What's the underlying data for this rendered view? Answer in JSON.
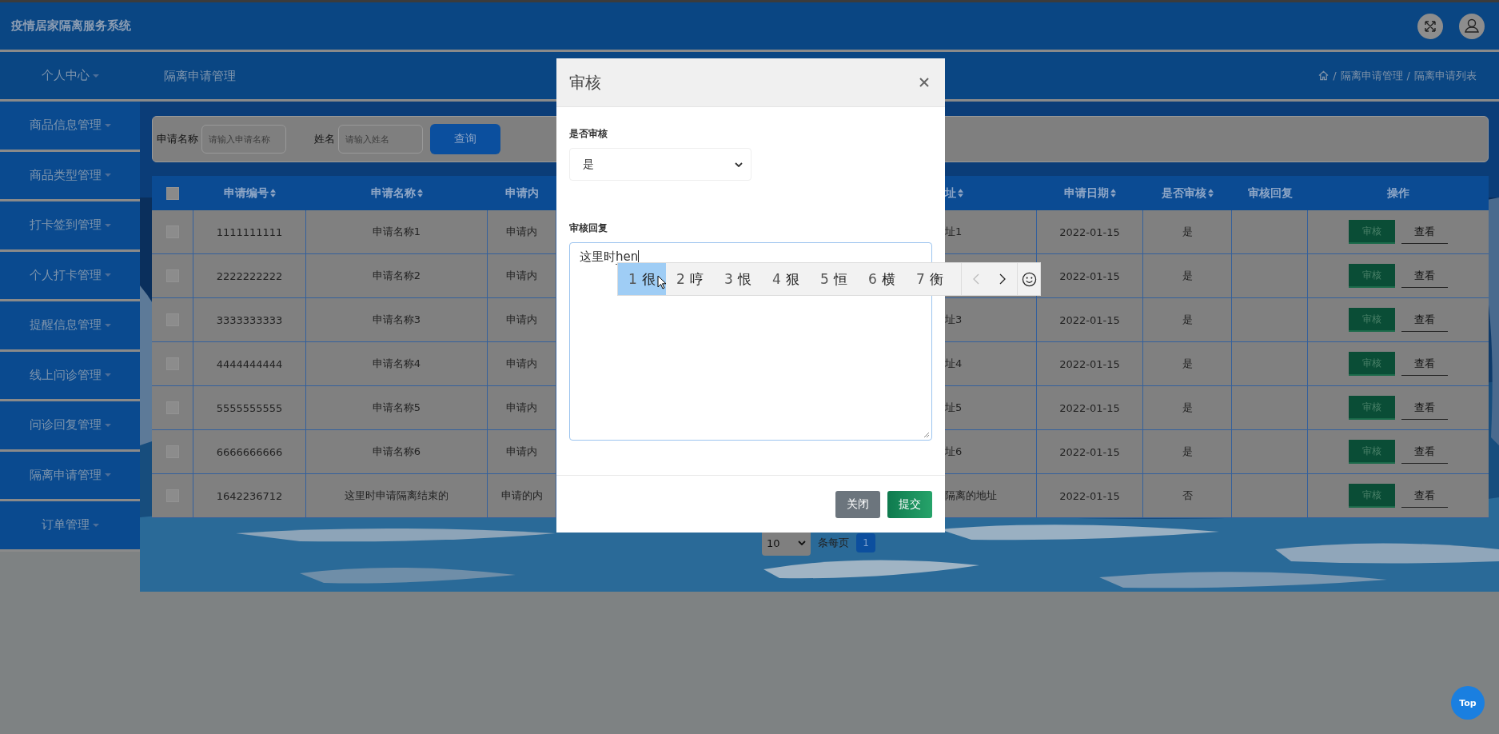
{
  "header": {
    "title": "疫情居家隔离服务系统"
  },
  "nav": {
    "user_menu": "个人中心",
    "page_title": "隔离申请管理",
    "breadcrumb": {
      "separator": "/",
      "items": [
        "隔离申请管理",
        "隔离申请列表"
      ]
    }
  },
  "sidebar": {
    "items": [
      "商品信息管理",
      "商品类型管理",
      "打卡签到管理",
      "个人打卡管理",
      "提醒信息管理",
      "线上问诊管理",
      "问诊回复管理",
      "隔离申请管理",
      "订单管理"
    ]
  },
  "search": {
    "fields": [
      {
        "label": "申请名称",
        "placeholder": "请输入申请名称"
      },
      {
        "label": "姓名",
        "placeholder": "请输入姓名"
      }
    ],
    "button": "查询"
  },
  "table": {
    "header_checked": false,
    "columns": [
      {
        "label": "申请编号",
        "sortable": true
      },
      {
        "label": "申请名称",
        "sortable": true
      },
      {
        "label": "申请内",
        "sortable": false
      },
      {
        "label": "址",
        "sortable": true
      },
      {
        "label": "申请日期",
        "sortable": true
      },
      {
        "label": "是否审核",
        "sortable": true
      },
      {
        "label": "审核回复",
        "sortable": false
      },
      {
        "label": "操作",
        "sortable": false
      }
    ],
    "rows": [
      {
        "checked": false,
        "id": "1111111111",
        "name": "申请名称1",
        "content": "申请内",
        "address": "址1",
        "date": "2022-01-15",
        "reviewed": "是",
        "actions": [
          "审核",
          "查看"
        ]
      },
      {
        "checked": false,
        "id": "2222222222",
        "name": "申请名称2",
        "content": "申请内",
        "date": "2022-01-15",
        "reviewed": "是",
        "actions": [
          "审核",
          "查看"
        ]
      },
      {
        "checked": false,
        "id": "3333333333",
        "name": "申请名称3",
        "content": "申请内",
        "address": "址3",
        "date": "2022-01-15",
        "reviewed": "是",
        "actions": [
          "审核",
          "查看"
        ]
      },
      {
        "checked": false,
        "id": "4444444444",
        "name": "申请名称4",
        "content": "申请内",
        "address": "址4",
        "date": "2022-01-15",
        "reviewed": "是",
        "actions": [
          "审核",
          "查看"
        ]
      },
      {
        "checked": false,
        "id": "5555555555",
        "name": "申请名称5",
        "content": "申请内",
        "address": "址5",
        "date": "2022-01-15",
        "reviewed": "是",
        "actions": [
          "审核",
          "查看"
        ]
      },
      {
        "checked": false,
        "id": "6666666666",
        "name": "申请名称6",
        "content": "申请内",
        "address": "址6",
        "date": "2022-01-15",
        "reviewed": "是",
        "actions": [
          "审核",
          "查看"
        ]
      },
      {
        "checked": false,
        "id": "1642236712",
        "name": "这里时申请隔离结束的",
        "content": "申请的内",
        "address": "隔离的地址",
        "date": "2022-01-15",
        "reviewed": "否",
        "actions": [
          "审核",
          "查看"
        ]
      }
    ]
  },
  "pagination": {
    "page_size": "10",
    "per_page_label": "条每页",
    "pages": [
      {
        "label": "1",
        "selected": true
      }
    ]
  },
  "modal": {
    "title": "审核",
    "fields": [
      {
        "kind": "select",
        "label": "是否审核",
        "value": "是"
      },
      {
        "kind": "textarea",
        "label": "审核回复",
        "value": "这里时",
        "composition": "hen"
      }
    ],
    "buttons": [
      {
        "label": "关闭",
        "kind": "secondary"
      },
      {
        "label": "提交",
        "kind": "primary"
      }
    ]
  },
  "ime": {
    "candidates": [
      {
        "number": "1",
        "text": "很",
        "selected": true
      },
      {
        "number": "2",
        "text": "哼",
        "selected": false
      },
      {
        "number": "3",
        "text": "恨",
        "selected": false
      },
      {
        "number": "4",
        "text": "狠",
        "selected": false
      },
      {
        "number": "5",
        "text": "恒",
        "selected": false
      },
      {
        "number": "6",
        "text": "横",
        "selected": false
      },
      {
        "number": "7",
        "text": "衡",
        "selected": false
      }
    ],
    "prev_disabled": true,
    "next_disabled": false
  },
  "top_button": "Top"
}
